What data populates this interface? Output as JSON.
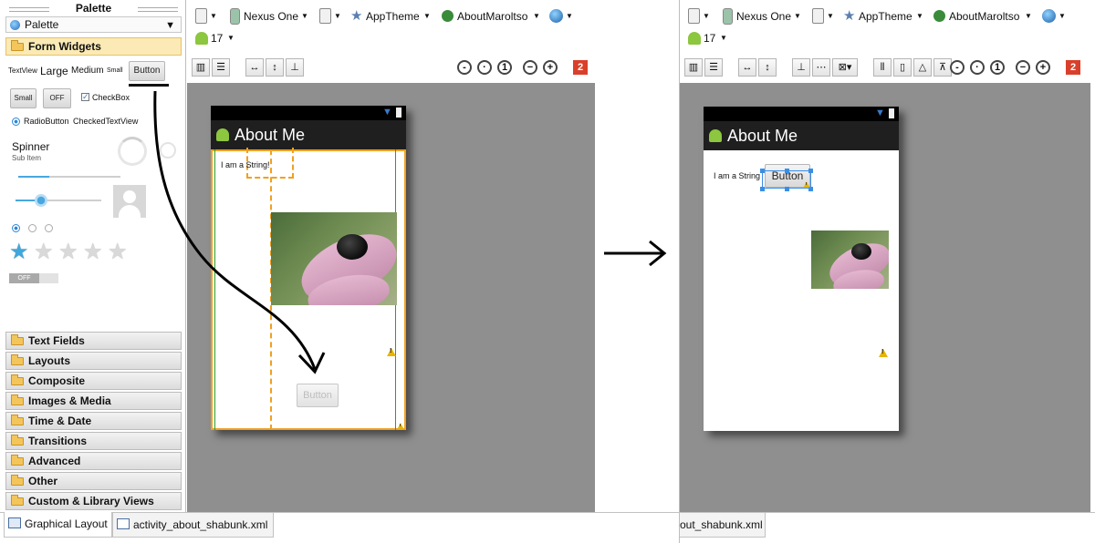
{
  "palette": {
    "title": "Palette",
    "header": "Palette",
    "active_category": "Form Widgets",
    "widgets": {
      "textview": "TextView",
      "large": "Large",
      "medium": "Medium",
      "small": "Small",
      "button": "Button",
      "small_button": "Small",
      "toggle_off": "OFF",
      "checkbox": "CheckBox",
      "radiobutton": "RadioButton",
      "checked_textview": "CheckedTextView",
      "spinner": "Spinner",
      "spinner_sub": "Sub Item",
      "switch_off": "OFF"
    },
    "categories": [
      "Text Fields",
      "Layouts",
      "Composite",
      "Images & Media",
      "Time & Date",
      "Transitions",
      "Advanced",
      "Other",
      "Custom & Library Views"
    ]
  },
  "toolbar": {
    "device": "Nexus One",
    "theme": "AppTheme",
    "activity": "AboutMaroltso",
    "api_level": "17",
    "error_count": "2"
  },
  "device_left": {
    "app_title": "About Me",
    "text": "I am a String!",
    "button": "Button"
  },
  "device_right": {
    "app_title": "About Me",
    "text": "I am a String",
    "button": "Button"
  },
  "tabs": {
    "graphical": "Graphical Layout",
    "xml": "activity_about_shabunk.xml",
    "xml_right": "out_shabunk.xml"
  }
}
